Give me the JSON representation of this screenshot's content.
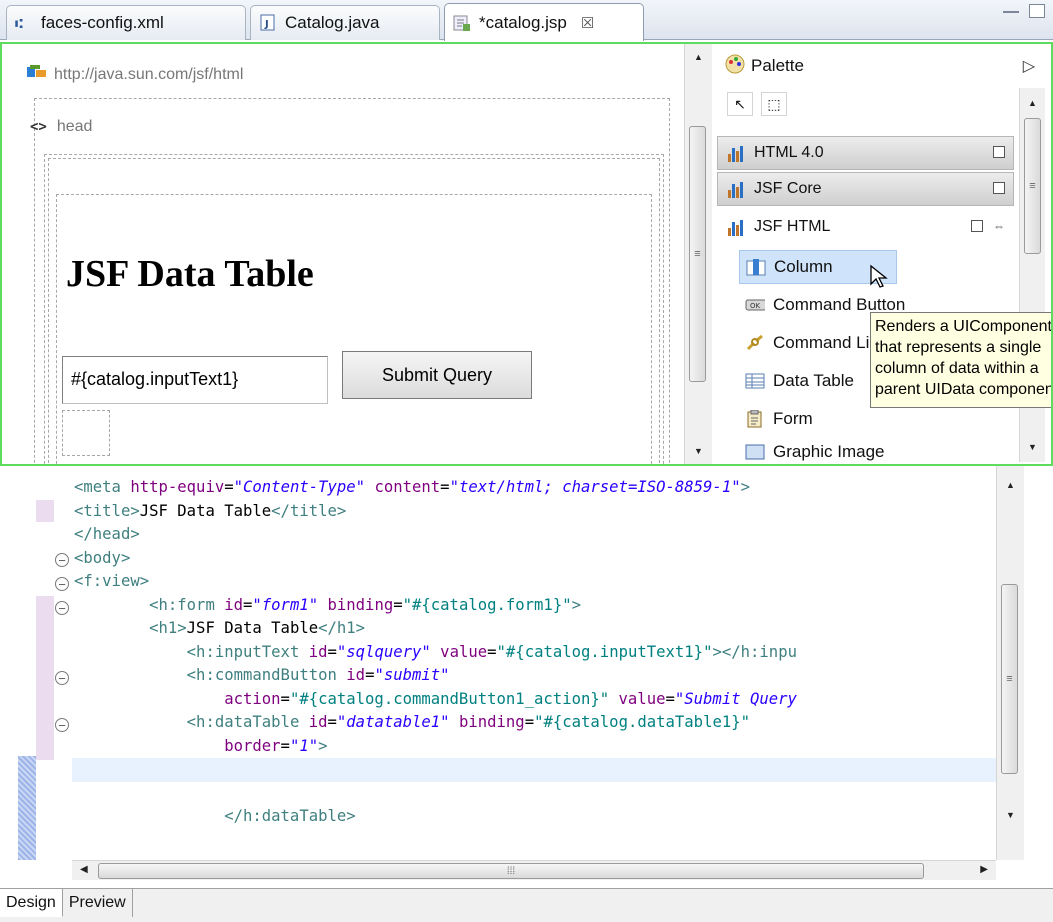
{
  "tabs": [
    {
      "label": "faces-config.xml",
      "icon": "faces-config-icon",
      "active": false
    },
    {
      "label": "Catalog.java",
      "icon": "java-file-icon",
      "active": false
    },
    {
      "label": "*catalog.jsp",
      "icon": "jsp-file-icon",
      "active": true,
      "close": "☒"
    }
  ],
  "design": {
    "namespace": "http://java.sun.com/jsf/html",
    "head_tag": "head",
    "heading": "JSF Data Table",
    "input_value": "#{catalog.inputText1}",
    "button_label": "Submit Query"
  },
  "palette": {
    "title": "Palette",
    "drawers": [
      {
        "label": "HTML 4.0",
        "open": false
      },
      {
        "label": "JSF Core",
        "open": false
      },
      {
        "label": "JSF HTML",
        "open": true
      }
    ],
    "entries": [
      {
        "label": "Column",
        "icon": "column-icon",
        "selected": true
      },
      {
        "label": "Command Button",
        "icon": "command-button-icon"
      },
      {
        "label": "Command Link",
        "icon": "command-link-icon"
      },
      {
        "label": "Data Table",
        "icon": "data-table-icon"
      },
      {
        "label": "Form",
        "icon": "form-icon"
      },
      {
        "label": "Graphic Image",
        "icon": "graphic-image-icon"
      }
    ],
    "tooltip": [
      "Renders a UIComponent",
      "that represents a single",
      "column of data within a",
      "parent UIData component"
    ]
  },
  "code_lines": [
    "<meta http-equiv=\"Content-Type\" content=\"text/html; charset=ISO-8859-1\">",
    "<title>JSF Data Table</title>",
    "</head>",
    "<body>",
    "<f:view>",
    "        <h:form id=\"form1\" binding=\"#{catalog.form1}\">",
    "        <h1>JSF Data Table</h1>",
    "            <h:inputText id=\"sqlquery\" value=\"#{catalog.inputText1}\"></h:inpu",
    "            <h:commandButton id=\"submit\"",
    "                action=\"#{catalog.commandButton1_action}\" value=\"Submit Query",
    "            <h:dataTable id=\"datatable1\" binding=\"#{catalog.dataTable1}\"",
    "                border=\"1\">",
    "",
    "",
    "                </h:dataTable>"
  ],
  "page_tabs": [
    {
      "label": "Design",
      "active": true
    },
    {
      "label": "Preview",
      "active": false
    }
  ],
  "colors": {
    "selection_border": "#5fdc5f",
    "tag": "#3f7f7f",
    "attribute": "#7f007f",
    "value": "#2a00ff"
  }
}
